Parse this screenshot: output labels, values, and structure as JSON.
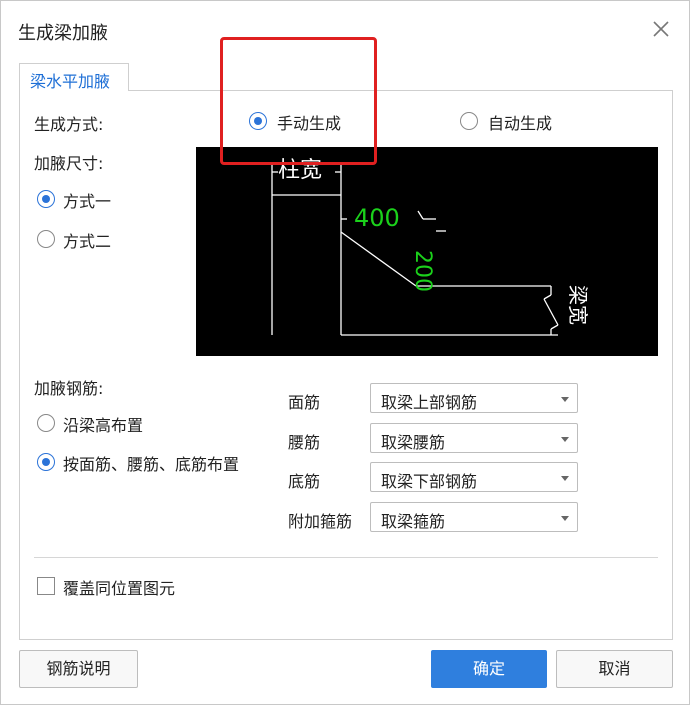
{
  "dialog": {
    "title": "生成梁加腋",
    "close_icon": "close-icon"
  },
  "tabs": [
    {
      "label": "梁水平加腋",
      "active": true
    }
  ],
  "generation": {
    "label": "生成方式:",
    "options": [
      {
        "label": "手动生成",
        "selected": true
      },
      {
        "label": "自动生成",
        "selected": false
      }
    ]
  },
  "haunch_size": {
    "label": "加腋尺寸:",
    "options": [
      {
        "label": "方式一",
        "selected": true
      },
      {
        "label": "方式二",
        "selected": false
      }
    ]
  },
  "diagram": {
    "column_width_label": "柱宽",
    "dim_horizontal": "400",
    "dim_vertical": "200",
    "beam_width_label": "梁宽",
    "colors": {
      "background": "#000000",
      "lines": "#ffffff",
      "dimensions": "#00ff00"
    }
  },
  "rebar": {
    "label": "加腋钢筋:",
    "options": [
      {
        "label": "沿梁高布置",
        "selected": false
      },
      {
        "label": "按面筋、腰筋、底筋布置",
        "selected": true
      }
    ],
    "fields": [
      {
        "label": "面筋",
        "value": "取梁上部钢筋"
      },
      {
        "label": "腰筋",
        "value": "取梁腰筋"
      },
      {
        "label": "底筋",
        "value": "取梁下部钢筋"
      },
      {
        "label": "附加箍筋",
        "value": "取梁箍筋"
      }
    ]
  },
  "overwrite": {
    "label": "覆盖同位置图元",
    "checked": false
  },
  "buttons": {
    "help": "钢筋说明",
    "ok": "确定",
    "cancel": "取消"
  },
  "colors": {
    "accent": "#2f7fde",
    "highlight_box": "#e02020"
  }
}
